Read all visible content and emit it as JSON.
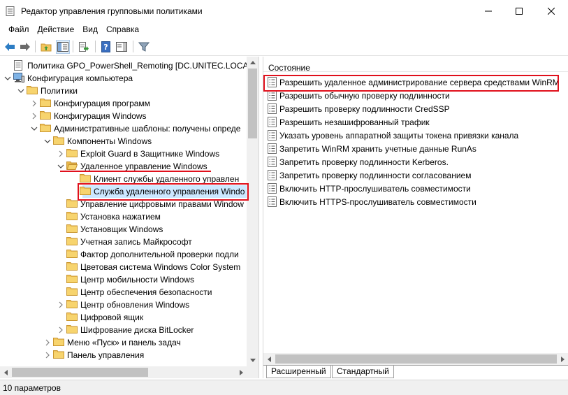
{
  "window": {
    "title": "Редактор управления групповыми политиками",
    "controls": [
      "minimize-icon",
      "maximize-icon",
      "close-icon"
    ]
  },
  "menu": [
    "Файл",
    "Действие",
    "Вид",
    "Справка"
  ],
  "toolbar": {
    "icons": [
      "back-arrow-icon",
      "forward-arrow-icon",
      "up-folder-icon",
      "show-hide-tree-icon",
      "export-list-icon",
      "help-icon",
      "properties-pane-icon",
      "filter-icon"
    ]
  },
  "tree": {
    "items": [
      {
        "label": "Политика GPO_PowerShell_Remoting [DC.UNITEC.LOCAL]",
        "expander": "none",
        "icon": "policy-icon"
      },
      {
        "label": "Конфигурация компьютера",
        "expander": "expanded",
        "icon": "computer-icon"
      },
      {
        "label": "Политики",
        "expander": "expanded",
        "icon": "folder-icon"
      },
      {
        "label": "Конфигурация программ",
        "expander": "collapsed",
        "icon": "folder-icon"
      },
      {
        "label": "Конфигурация Windows",
        "expander": "collapsed",
        "icon": "folder-icon"
      },
      {
        "label": "Административные шаблоны: получены опреде",
        "expander": "expanded",
        "icon": "folder-icon"
      },
      {
        "label": "Компоненты Windows",
        "expander": "expanded",
        "icon": "folder-icon"
      },
      {
        "label": "Exploit Guard в Защитнике Windows",
        "expander": "collapsed",
        "icon": "folder-icon"
      },
      {
        "label": "Удаленное управление Windows",
        "expander": "expanded",
        "icon": "folder-open-icon"
      },
      {
        "label": "Клиент службы удаленного управлен",
        "expander": "none",
        "icon": "folder-icon"
      },
      {
        "label": "Служба удаленного управления Windo",
        "expander": "none",
        "icon": "folder-icon",
        "selected": true
      },
      {
        "label": "Управление цифровыми правами Window",
        "expander": "none",
        "icon": "folder-icon"
      },
      {
        "label": "Установка нажатием",
        "expander": "none",
        "icon": "folder-icon"
      },
      {
        "label": "Установщик Windows",
        "expander": "none",
        "icon": "folder-icon"
      },
      {
        "label": "Учетная запись Майкрософт",
        "expander": "none",
        "icon": "folder-icon"
      },
      {
        "label": "Фактор дополнительной проверки подли",
        "expander": "none",
        "icon": "folder-icon"
      },
      {
        "label": "Цветовая система Windows Color System",
        "expander": "none",
        "icon": "folder-icon"
      },
      {
        "label": "Центр мобильности Windows",
        "expander": "none",
        "icon": "folder-icon"
      },
      {
        "label": "Центр обеспечения безопасности",
        "expander": "none",
        "icon": "folder-icon"
      },
      {
        "label": "Центр обновления Windows",
        "expander": "collapsed",
        "icon": "folder-icon"
      },
      {
        "label": "Цифровой ящик",
        "expander": "none",
        "icon": "folder-icon"
      },
      {
        "label": "Шифрование диска BitLocker",
        "expander": "collapsed",
        "icon": "folder-icon"
      },
      {
        "label": "Меню «Пуск» и панель задач",
        "expander": "collapsed",
        "icon": "folder-icon"
      },
      {
        "label": "Панель управления",
        "expander": "collapsed",
        "icon": "folder-icon"
      }
    ]
  },
  "settings": {
    "column_header": "Состояние",
    "items": [
      "Разрешить удаленное администрирование сервера средствами WinRM",
      "Разрешить обычную проверку подлинности",
      "Разрешить проверку подлинности CredSSP",
      "Разрешить незашифрованный трафик",
      "Указать уровень аппаратной защиты токена привязки канала",
      "Запретить WinRM хранить учетные данные RunAs",
      "Запретить проверку подлинности Kerberos.",
      "Запретить проверку подлинности согласованием",
      "Включить HTTP-прослушиватель совместимости",
      "Включить HTTPS-прослушиватель совместимости"
    ]
  },
  "tabs": [
    "Расширенный",
    "Стандартный"
  ],
  "status": "10 параметров",
  "colors": {
    "highlight": "#e0101c",
    "folder": "#f2c55c",
    "selection": "#cce8ff"
  }
}
